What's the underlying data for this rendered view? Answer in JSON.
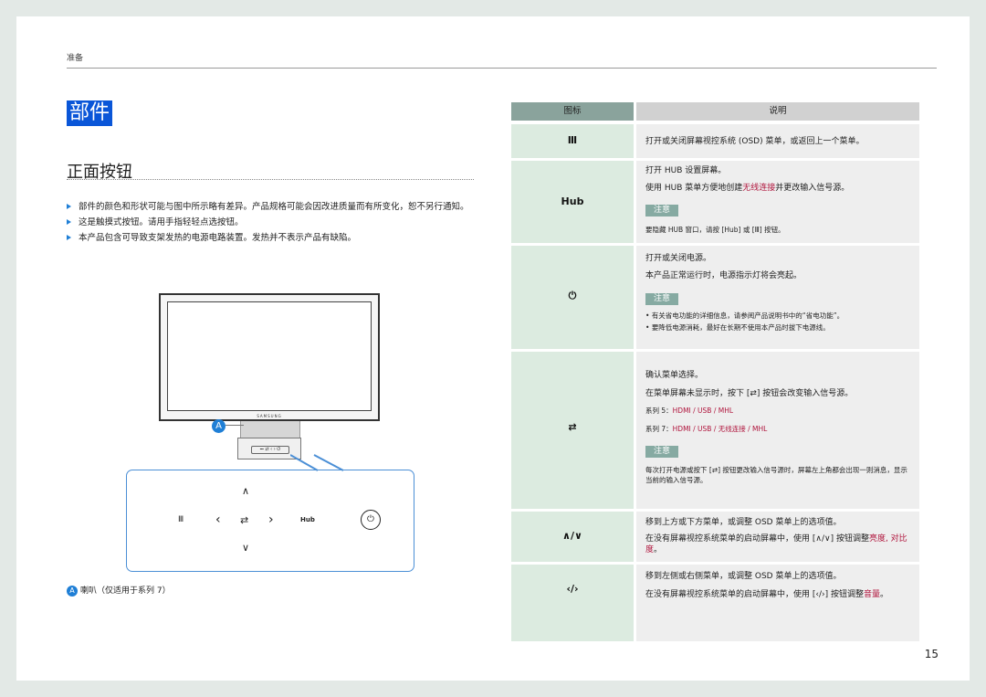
{
  "section": "准备",
  "page_title": "部件",
  "sub_title": "正面按钮",
  "bullets": [
    "部件的颜色和形状可能与图中所示略有差异。产品规格可能会因改进质量而有所变化，恕不另行通知。",
    "这是触摸式按钮。请用手指轻轻点选按钮。",
    "本产品包含可导致支架发热的电源电路装置。发热并不表示产品有缺陷。"
  ],
  "figure": {
    "brand": "SAMSUNG",
    "marker": "A",
    "zoom_buttons": {
      "menu": "Ⅲ",
      "up": "∧",
      "left": "‹",
      "source": "⇄",
      "right": "›",
      "hub": "Hub",
      "down": "∨",
      "power": "⏻"
    },
    "caption_marker": "A",
    "caption": "喇叭（仅适用于系列 7）"
  },
  "table": {
    "header_icon": "图标",
    "header_desc": "说明",
    "rows": [
      {
        "icon": "Ⅲ",
        "text1": "打开或关闭屏幕视控系统 (OSD) 菜单，或返回上一个菜单。"
      },
      {
        "icon": "Hub",
        "text1": "打开 HUB 设置屏幕。",
        "text2_pre": "使用 HUB 菜单方便地创建",
        "text2_hl": "无线连接",
        "text2_post": "并更改输入信号源。",
        "note": "注意",
        "note_text": "要隐藏 HUB 窗口，请按 [Hub] 或 [Ⅲ] 按钮。"
      },
      {
        "icon": "⏻",
        "text1": "打开或关闭电源。",
        "text2": "本产品正常运行时，电源指示灯将会亮起。",
        "note": "注意",
        "n1": "有关省电功能的详细信息，请参阅产品说明书中的“省电功能”。",
        "n2": "要降低电源消耗，最好在长期不使用本产品时拔下电源线。"
      },
      {
        "icon": "⇄",
        "text1": "确认菜单选择。",
        "text2": "在菜单屏幕未显示时，按下 [⇄] 按钮会改变输入信号源。",
        "s5": "系列 5：",
        "s5v": "HDMI / USB / MHL",
        "s7": "系列 7：",
        "s7v": "HDMI / USB / 无线连接 / MHL",
        "note": "注意",
        "note_text": "每次打开电源或按下 [⇄] 按钮更改输入信号源时，屏幕左上角都会出现一则消息，显示当前的输入信号源。"
      },
      {
        "icon": "∧/∨",
        "text1": "移到上方或下方菜单，或调整 OSD 菜单上的选项值。",
        "text2_pre": "在没有屏幕视控系统菜单的启动屏幕中，使用 [∧/∨] 按钮调整",
        "text2_hl": "亮度, 对比度",
        "text2_post": "。"
      },
      {
        "icon": "‹/›",
        "text1": "移到左侧或右侧菜单，或调整 OSD 菜单上的选项值。",
        "text2_pre": "在没有屏幕视控系统菜单的启动屏幕中，使用 [‹/›] 按钮调整",
        "text2_hl": "音量",
        "text2_post": "。"
      }
    ]
  },
  "page_number": "15"
}
